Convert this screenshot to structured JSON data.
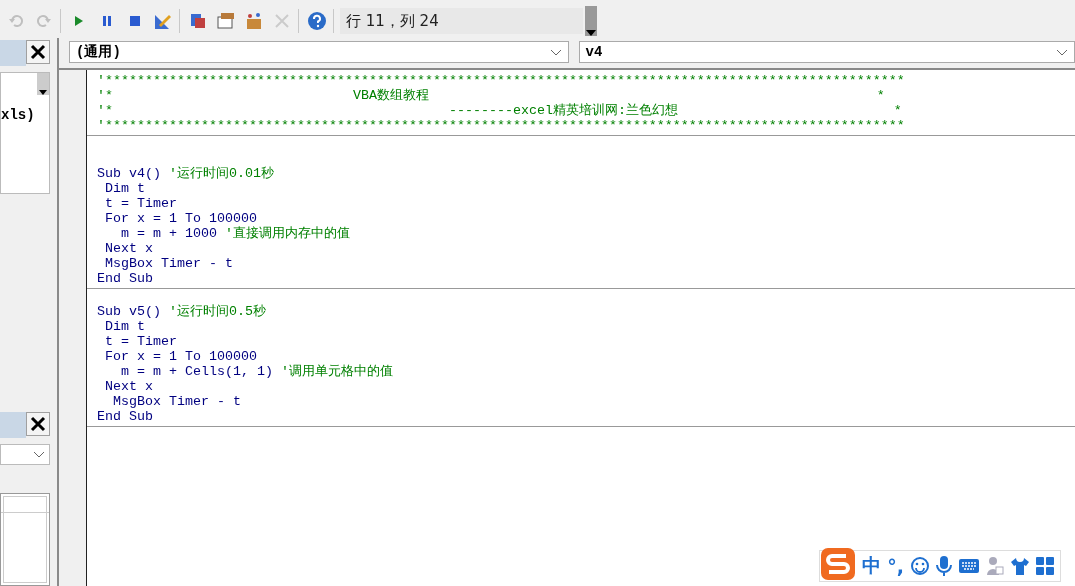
{
  "toolbar": {
    "groups": [
      [
        {
          "kind": "undo",
          "disabled": true
        },
        {
          "kind": "redo",
          "disabled": true
        }
      ],
      [
        {
          "kind": "run",
          "disabled": false
        },
        {
          "kind": "pause",
          "disabled": false
        },
        {
          "kind": "stop",
          "disabled": false
        },
        {
          "kind": "design",
          "disabled": false
        }
      ],
      [
        {
          "kind": "explorer",
          "disabled": false
        },
        {
          "kind": "properties",
          "disabled": false
        },
        {
          "kind": "browser",
          "disabled": false
        },
        {
          "kind": "toolbox",
          "disabled": true
        }
      ],
      [
        {
          "kind": "help",
          "disabled": false
        }
      ]
    ],
    "position": "行 11，列 24"
  },
  "project_panel": {
    "tree_text": "xls)"
  },
  "code_window": {
    "object_combo": "(通用)",
    "procedure_combo": "v4",
    "sections": [
      {
        "lines": [
          {
            "comment": "'****************************************************************************************************"
          },
          {
            "comment": "'*                              VBA数组教程                                                        *"
          },
          {
            "comment": "'*                                          --------excel精英培训网:兰色幻想                           *"
          },
          {
            "comment": "'****************************************************************************************************"
          }
        ]
      },
      {
        "lines": [
          {
            "code": "Sub v4() ",
            "comment": "'运行时间0.01秒"
          },
          {
            "code": " Dim t"
          },
          {
            "code": " t = Timer"
          },
          {
            "code": " For x = 1 To 100000"
          },
          {
            "code": "   m = m + 1000 ",
            "comment": "'直接调用内存中的值"
          },
          {
            "code": " Next x"
          },
          {
            "code": " MsgBox Timer - t"
          },
          {
            "code": "End Sub"
          }
        ]
      },
      {
        "lines": [
          {
            "code": "Sub v5() ",
            "comment": "'运行时间0.5秒"
          },
          {
            "code": " Dim t"
          },
          {
            "code": " t = Timer"
          },
          {
            "code": " For x = 1 To 100000"
          },
          {
            "code": "   m = m + Cells(1, 1) ",
            "comment": "'调用单元格中的值"
          },
          {
            "code": " Next x"
          },
          {
            "code": "  MsgBox Timer - t"
          },
          {
            "code": "End Sub"
          }
        ]
      }
    ]
  },
  "ime": {
    "mode": "中",
    "punctuation": "°,"
  }
}
